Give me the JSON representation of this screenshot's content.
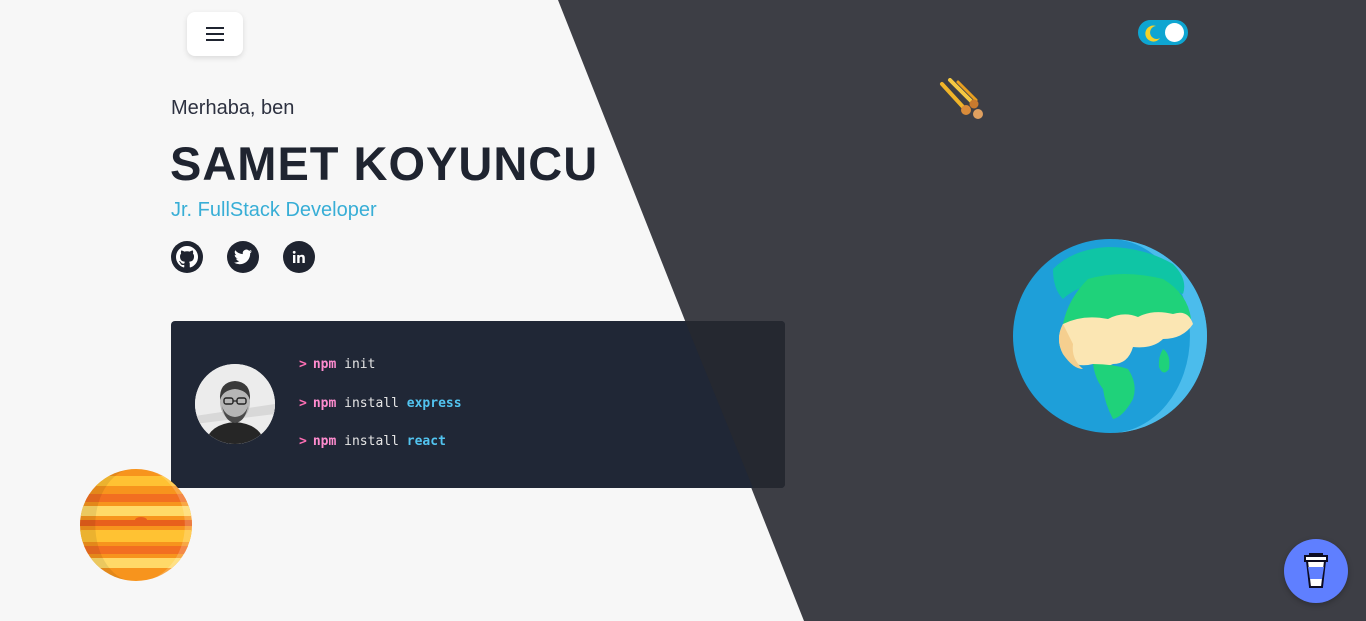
{
  "header": {
    "menu_icon": "hamburger-menu-icon",
    "theme_toggle": {
      "icon": "moon-icon",
      "state": "dark"
    }
  },
  "hero": {
    "greeting": "Merhaba, ben",
    "name": "SAMET KOYUNCU",
    "role": "Jr. FullStack Developer",
    "socials": [
      {
        "name": "github",
        "icon": "github-icon"
      },
      {
        "name": "twitter",
        "icon": "twitter-icon"
      },
      {
        "name": "linkedin",
        "icon": "linkedin-icon"
      }
    ]
  },
  "terminal": {
    "prompt": ">",
    "lines": [
      {
        "cmd": "npm",
        "args": "init",
        "pkg": ""
      },
      {
        "cmd": "npm",
        "args": "install",
        "pkg": "express"
      },
      {
        "cmd": "npm",
        "args": "install",
        "pkg": "react"
      }
    ]
  },
  "decorations": [
    "meteor-icon",
    "earth-icon",
    "jupiter-icon"
  ],
  "fab": {
    "icon": "coffee-cup-icon"
  },
  "colors": {
    "light_bg": "#f7f7f7",
    "dark_bg": "#3d3e45",
    "accent": "#38aed6",
    "text_dark": "#1f2430",
    "terminal_bg": "#202736",
    "fab_bg": "#5f7fff"
  }
}
